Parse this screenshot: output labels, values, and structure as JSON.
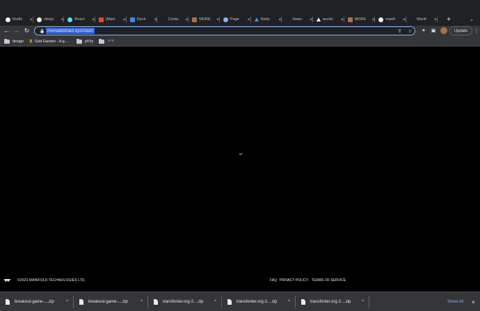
{
  "tabs": [
    {
      "title": "Rodki",
      "icon": "github-icon",
      "color": "#f1f3f4"
    },
    {
      "title": "vitorja",
      "icon": "github-icon",
      "color": "#f1f3f4"
    },
    {
      "title": "React",
      "icon": "react-icon",
      "color": "#61dafb"
    },
    {
      "title": "[Marii",
      "icon": "gmail-icon",
      "color": "#ea4335"
    },
    {
      "title": "Deck",
      "icon": "document-icon",
      "color": "#4285f4"
    },
    {
      "title": "Conta",
      "icon": "blank-icon",
      "color": "#202124"
    },
    {
      "title": "MORE",
      "icon": "site-icon",
      "color": "#b06f4a"
    },
    {
      "title": "Page",
      "icon": "figma-icon",
      "color": "#8ab4f8"
    },
    {
      "title": "Redu",
      "icon": "triangle-icon",
      "color": "#4a90d9"
    },
    {
      "title": "Searc",
      "icon": "blank-icon",
      "color": "#202124"
    },
    {
      "title": "auctio",
      "icon": "triangle-icon",
      "color": "#f1f3f4"
    },
    {
      "title": "MORE",
      "icon": "site-icon",
      "color": "#b06f4a"
    },
    {
      "title": "manif",
      "icon": "github-icon",
      "color": "#f1f3f4"
    },
    {
      "title": "Manif",
      "icon": "blank-icon",
      "color": "#202124"
    }
  ],
  "toolbar": {
    "url": "moreabstract.xyz/claim",
    "update_label": "Update"
  },
  "bookmarks": [
    {
      "label": "design",
      "icon": "folder-icon"
    },
    {
      "label": "Grid Garden - A g...",
      "icon": "hourglass-icon"
    },
    {
      "label": "p5*js",
      "icon": "folder-icon"
    },
    {
      "label": "ᄁᄁ",
      "icon": "folder-icon"
    }
  ],
  "footer": {
    "copyright": "©2023 MANIFOLD TECHNOLOGIES LTD.",
    "links": [
      "FAQ",
      "PRIVACY POLICY",
      "TERMS OF SERVICE"
    ]
  },
  "downloads": {
    "items": [
      "breakout-game-....zip",
      "breakout-game-....zip",
      "transfonter.org-2....zip",
      "transfonter.org-2....zip",
      "transfonter.org-2....zip"
    ],
    "show_all_label": "Show All"
  }
}
